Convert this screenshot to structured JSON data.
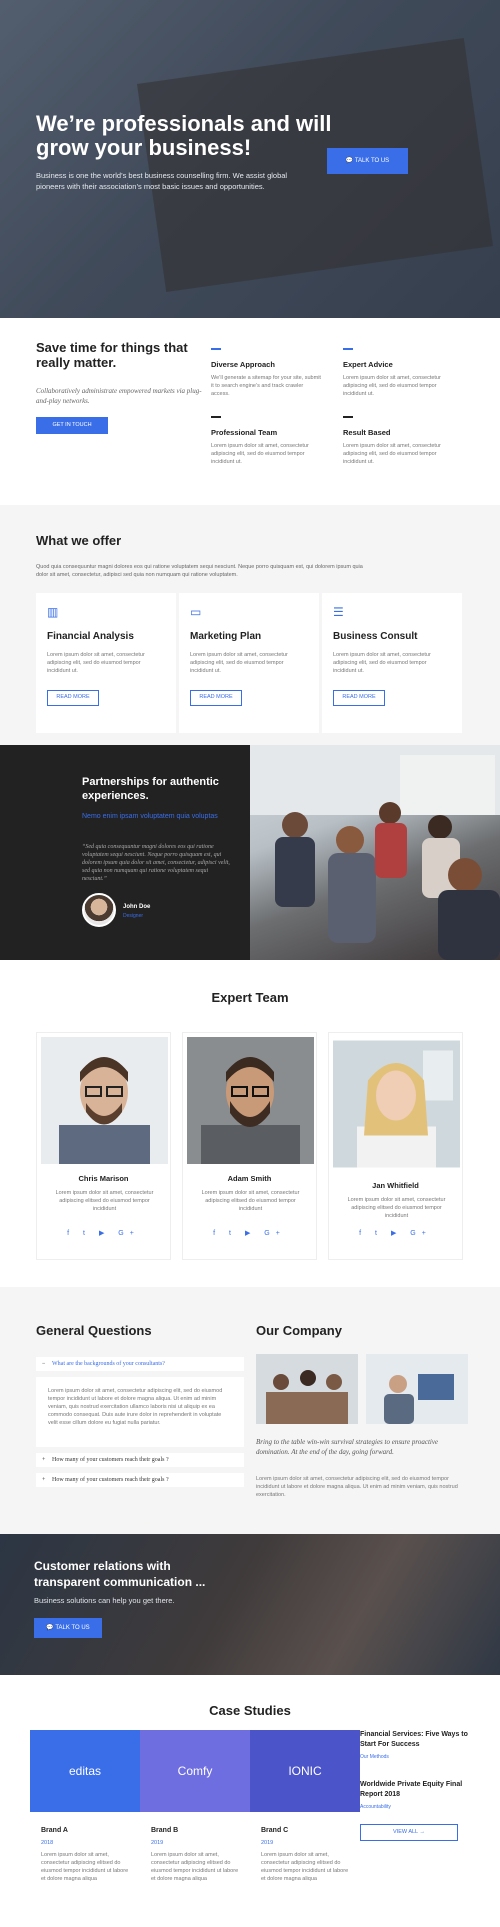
{
  "hero": {
    "title": "We’re professionals and will grow your business!",
    "text": "Business is one the world’s best business counselling firm. We assist global pioneers with their association’s most basic issues and opportunities.",
    "cta": "TALK TO US",
    "cta_icon": "chat-icon"
  },
  "intro": {
    "title": "Save time for things that really matter.",
    "lead": "Collaboratively administrate empowered markets via plug-and-play networks.",
    "cta": "GET IN TOUCH",
    "features": [
      {
        "title": "Diverse Approach",
        "text": "We’ll generate a sitemap for your site, submit it to search engine’s and track crawler access."
      },
      {
        "title": "Expert Advice",
        "text": "Lorem ipsum dolor sit amet, consectetur adipiscing elit, sed do eiusmod tempor incididunt ut."
      },
      {
        "title": "Professional Team",
        "text": "Lorem ipsum dolor sit amet, consectetur adipiscing elit, sed do eiusmod tempor incididunt ut."
      },
      {
        "title": "Result Based",
        "text": "Lorem ipsum dolor sit amet, consectetur adipiscing elit, sed do eiusmod tempor incididunt ut."
      }
    ]
  },
  "offer": {
    "title": "What we offer",
    "text": "Quod quia consequuntur magni dolores eos qui ratione voluptatem sequi nesciunt. Neque porro quisquam est, qui dolorem ipsum quia dolor sit amet, consectetur, adipisci sed quia non numquam qui ratione voluptatem.",
    "cards": [
      {
        "title": "Financial Analysis",
        "text": "Lorem ipsum dolor sit amet, consectetur adipiscing elit, sed do eiusmod tempor incididunt ut.",
        "btn": "READ MORE",
        "icon": "bar-chart-icon"
      },
      {
        "title": "Marketing Plan",
        "text": "Lorem ipsum dolor sit amet, consectetur adipiscing elit, sed do eiusmod tempor incididunt ut.",
        "btn": "READ MORE",
        "icon": "speech-bubble-icon"
      },
      {
        "title": "Business Consult",
        "text": "Lorem ipsum dolor sit amet, consectetur adipiscing elit, sed do eiusmod tempor incididunt ut.",
        "btn": "READ MORE",
        "icon": "list-icon"
      }
    ]
  },
  "partner": {
    "title": "Partnerships for authentic experiences.",
    "subtitle": "Nemo enim ipsam voluptatem quia voluptas",
    "quote": "“Sed quia consequuntur magni dolores eos qui ratione voluptatem sequi nesciunt. Neque porro quisquam est, qui dolorem ipsum quia dolor sit amet, consectetur, adipisci velit, sed quia non numquam qui ratione voluptatem sequi nesciunt.”",
    "name": "John Doe",
    "role": "Designer"
  },
  "team": {
    "title": "Expert Team",
    "members": [
      {
        "name": "Chris Marison",
        "text": "Lorem ipsum dolor sit amet, consectetur adipiscing elitsed do eiusmod tempor incididunt"
      },
      {
        "name": "Adam Smith",
        "text": "Lorem ipsum dolor sit amet, consectetur adipiscing elitsed do eiusmod tempor incididunt"
      },
      {
        "name": "Jan Whitfield",
        "text": "Lorem ipsum dolor sit amet, consectetur adipiscing elitsed do eiusmod tempor incididunt"
      }
    ],
    "social": "f  t  ▶  G+"
  },
  "faq": {
    "title": "General Questions",
    "q1": "What are the backgrounds of your consultants?",
    "a1": "Lorem ipsum dolor sit amet, consectetur adipiscing elit, sed do eiusmod tempor incididunt ut labore et dolore magna aliqua. Ut enim ad minim veniam, quis nostrud exercitation ullamco laboris nisi ut aliquip ex ea commodo consequat. Duis aute irure dolor in reprehenderit in voluptate velit esse cillum dolore eu fugiat nulla pariatur.",
    "q2": "How many of your customers reach their goals ?",
    "q3": "How many of your customers reach their goals ?",
    "open_sign": "−",
    "closed_sign": "+"
  },
  "company": {
    "title": "Our Company",
    "quote": "Bring to the table win-win survival strategies to ensure proactive domination. At the end of the day, going forward.",
    "text": "Lorem ipsum dolor sit amet, consectetur adipiscing elit, sed do eiusmod tempor incididunt ut labore et dolore magna aliqua. Ut enim ad minim veniam, quis nostrud exercitation."
  },
  "customer": {
    "title": "Customer relations with transparent communication ...",
    "text": "Business solutions can help you get there.",
    "cta": "TALK TO US"
  },
  "cases": {
    "title": "Case Studies",
    "items": [
      {
        "logo": "editas",
        "name": "Brand A",
        "year": "2018",
        "text": "Lorem ipsum dolor sit amet, consectetur adipiscing elitsed do eiusmod tempor incididunt ut labore et dolore magna aliqua",
        "color": "#3a6ee8"
      },
      {
        "logo": "Comfy",
        "name": "Brand B",
        "year": "2019",
        "text": "Lorem ipsum dolor sit amet, consectetur adipiscing elitsed do eiusmod tempor incididunt ut labore et dolore magna aliqua",
        "color": "#6f6ee0"
      },
      {
        "logo": "IONIC",
        "name": "Brand C",
        "year": "2019",
        "text": "Lorem ipsum dolor sit amet, consectetur adipiscing elitsed do eiusmod tempor incididunt ut labore et dolore magna aliqua",
        "color": "#4b54c8"
      }
    ],
    "side": [
      {
        "title": "Financial Services: Five Ways to Start For Success",
        "cat": "Our Methods"
      },
      {
        "title": "Worldwide Private Equity Final Report 2018",
        "cat": "Accountability"
      }
    ],
    "view_all": "VIEW ALL  →"
  }
}
